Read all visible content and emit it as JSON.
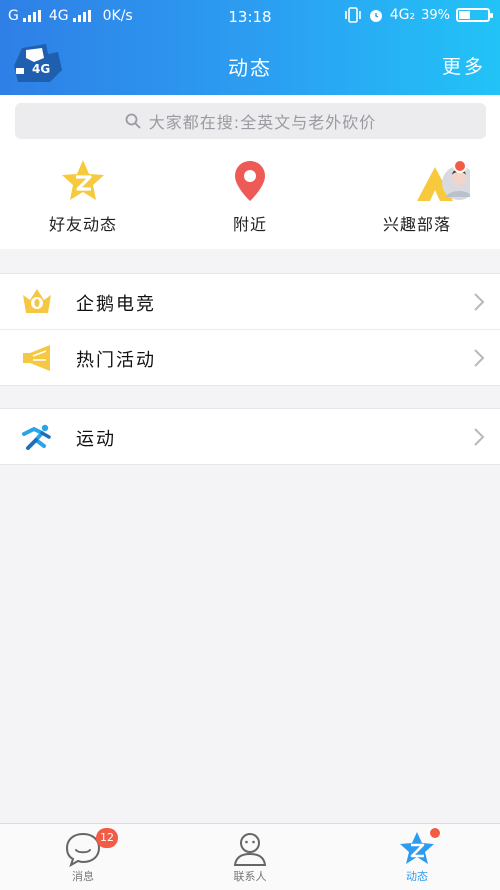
{
  "status_bar": {
    "carrier": "G",
    "network1": "4G",
    "speed": "0K/s",
    "time": "13:18",
    "network2": "4G₂",
    "battery": "39%",
    "battery_level": 0.39
  },
  "header": {
    "avatar_text": "4G",
    "title": "动态",
    "more": "更多"
  },
  "search": {
    "placeholder": "大家都在搜:全英文与老外砍价"
  },
  "quick_actions": [
    {
      "label": "好友动态",
      "icon": "star-z-icon"
    },
    {
      "label": "附近",
      "icon": "location-pin-icon"
    },
    {
      "label": "兴趣部落",
      "icon": "tribe-icon"
    }
  ],
  "list_groups": [
    [
      {
        "label": "企鹅电竞",
        "icon": "crown-icon"
      },
      {
        "label": "热门活动",
        "icon": "megaphone-icon"
      }
    ],
    [
      {
        "label": "运动",
        "icon": "running-icon"
      }
    ]
  ],
  "tabs": [
    {
      "label": "消息",
      "icon": "chat-icon",
      "badge": "12"
    },
    {
      "label": "联系人",
      "icon": "contacts-icon"
    },
    {
      "label": "动态",
      "icon": "star-tab-icon",
      "active": true
    }
  ],
  "colors": {
    "header_start": "#2f7fe6",
    "header_end": "#22c3f7",
    "accent_yellow": "#f7c93c",
    "pin_red": "#ee5b57",
    "badge_red": "#f35b45",
    "active_blue": "#2d9cf0"
  }
}
